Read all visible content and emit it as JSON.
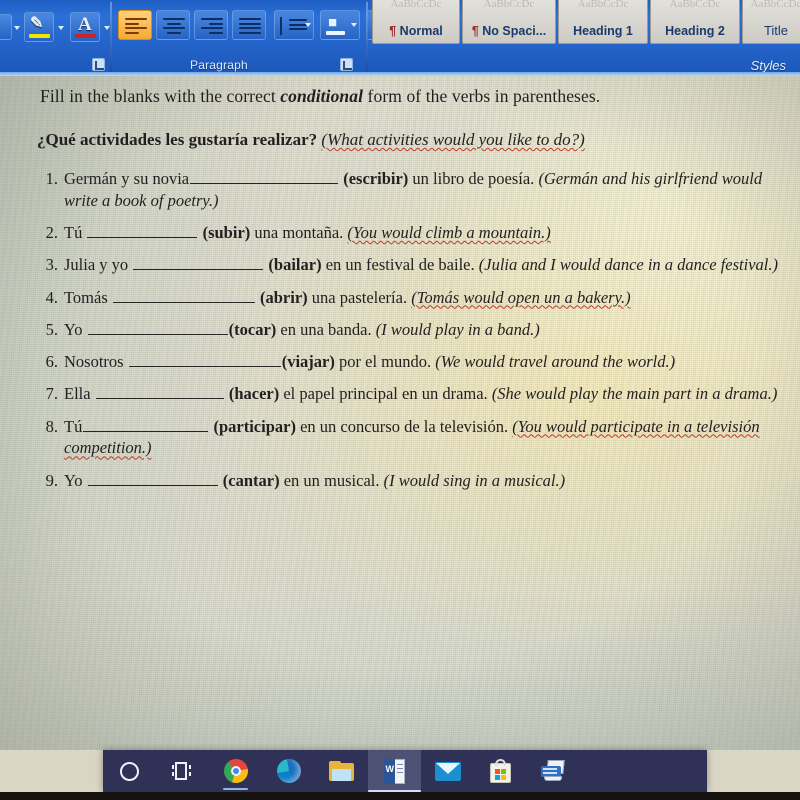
{
  "app": {
    "name": "Microsoft Word",
    "ribbon": {
      "groups": [
        {
          "label": "Paragraph"
        }
      ],
      "font_group": {
        "highlight_color_button": "text-highlight-color",
        "highlight_bar_color": "#f2e600",
        "font_color_button": "font-color",
        "font_color_bar_color": "#cc2222",
        "letter": "A"
      },
      "paragraph_group": {
        "label": "Paragraph",
        "buttons": [
          "align-left",
          "align-center",
          "align-right",
          "justify",
          "line-spacing",
          "shading",
          "borders"
        ],
        "active_button": "align-left"
      },
      "styles_group": {
        "label": "Styles",
        "preview_text": "AaBbCcDc",
        "items": [
          {
            "pilcrow": "¶",
            "label": "Normal"
          },
          {
            "pilcrow": "¶",
            "label": "No Spaci..."
          },
          {
            "pilcrow": "",
            "label": "Heading 1"
          },
          {
            "pilcrow": "",
            "label": "Heading 2"
          },
          {
            "pilcrow": "",
            "label": "Title"
          }
        ]
      }
    }
  },
  "document": {
    "instruction": {
      "before": "Fill in the blanks with the correct ",
      "emphasis": "conditional",
      "after": " form of the verbs in parentheses."
    },
    "heading": {
      "spanish": "¿Qué actividades les gustaría realizar?",
      "english": "(What activities would you like to do?)"
    },
    "items": [
      {
        "number": "1.",
        "subject": "Germán y su novia",
        "blank_width": 148,
        "verb": "(escribir)",
        "rest": " un libro de poesía.",
        "translation": "(Germán and his girlfriend would write a book of poetry.)"
      },
      {
        "number": "2.",
        "subject": "Tú ",
        "blank_width": 110,
        "verb": "(subir)",
        "rest": " una montaña.",
        "translation": "(You would climb a mountain.)"
      },
      {
        "number": "3.",
        "subject": "Julia y yo ",
        "blank_width": 130,
        "verb": "(bailar)",
        "rest": " en un festival de baile.",
        "translation": "(Julia and I would dance in a dance festival.)"
      },
      {
        "number": "4.",
        "subject": "Tomás ",
        "blank_width": 142,
        "verb": "(abrir)",
        "rest": " una pastelería.",
        "translation": "(Tomás would open un a bakery.)"
      },
      {
        "number": "5.",
        "subject": "Yo ",
        "blank_width": 140,
        "verb": "(tocar)",
        "rest": " en una banda.",
        "translation": "(I would play in a band.)"
      },
      {
        "number": "6.",
        "subject": "Nosotros ",
        "blank_width": 152,
        "verb": "(viajar)",
        "rest": " por el mundo.",
        "translation": "(We would travel around the world.)"
      },
      {
        "number": "7.",
        "subject": "Ella ",
        "blank_width": 128,
        "verb": "(hacer)",
        "rest": " el papel principal en un drama.",
        "translation": "(She would play the main part in a drama.)"
      },
      {
        "number": "8.",
        "subject": "Tú",
        "blank_width": 125,
        "verb": "(participar)",
        "rest": " en un concurso de la televisión.",
        "translation": "(You would participate in a televisión competition.)"
      },
      {
        "number": "9.",
        "subject": "Yo ",
        "blank_width": 130,
        "verb": "(cantar)",
        "rest": " en un musical.",
        "translation": "(I would sing in a musical.)"
      }
    ]
  },
  "taskbar": {
    "items": [
      {
        "name": "cortana-icon",
        "label": "Cortana"
      },
      {
        "name": "task-view-icon",
        "label": "Task View"
      },
      {
        "name": "chrome-icon",
        "label": "Google Chrome"
      },
      {
        "name": "edge-icon",
        "label": "Microsoft Edge"
      },
      {
        "name": "file-explorer-icon",
        "label": "File Explorer"
      },
      {
        "name": "word-icon",
        "label": "Microsoft Word"
      },
      {
        "name": "mail-icon",
        "label": "Mail"
      },
      {
        "name": "microsoft-store-icon",
        "label": "Microsoft Store"
      },
      {
        "name": "scanner-icon",
        "label": "Scan"
      }
    ]
  },
  "colors": {
    "ribbon_blue": "#2463c9",
    "taskbar": "#2f3157",
    "page_warm": "#f7ecbe",
    "page_cool": "#c4cdc0",
    "spellcheck_red": "#c0392b",
    "accent_orange": "#f6a932"
  }
}
